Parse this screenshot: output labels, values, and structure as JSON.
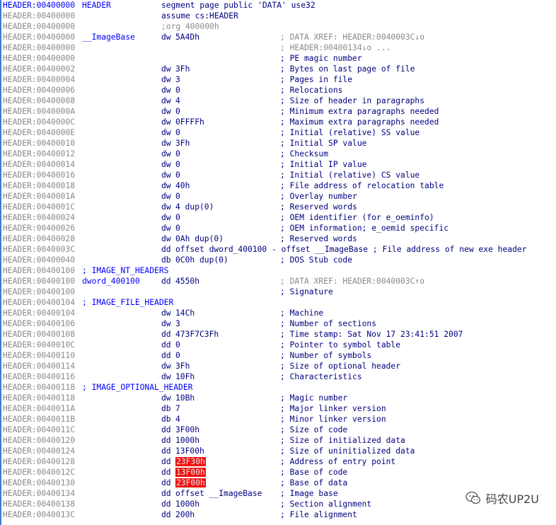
{
  "listing": {
    "lines": [
      {
        "addr": "HEADER:00400000",
        "label": "HEADER",
        "mn": "segment page public 'DATA' use32",
        "op": "",
        "comment": "",
        "xref": "",
        "first": true
      },
      {
        "addr": "HEADER:00400000",
        "label": "",
        "mn": "assume cs:HEADER",
        "op": "",
        "comment": "",
        "xref": ""
      },
      {
        "addr": "HEADER:00400000",
        "label": "",
        "mn": "",
        "op": ";org 400000h",
        "org": true,
        "comment": "",
        "xref": ""
      },
      {
        "addr": "HEADER:00400000",
        "label": "__ImageBase",
        "mn": "dw",
        "op": "5A4Dh",
        "comment": "",
        "xref": "; DATA XREF: HEADER:0040003C↓o"
      },
      {
        "addr": "HEADER:00400000",
        "label": "",
        "mn": "",
        "op": "",
        "comment": "",
        "xref": "; HEADER:00400134↓o ..."
      },
      {
        "addr": "HEADER:00400000",
        "label": "",
        "mn": "",
        "op": "",
        "comment": "; PE magic number",
        "xref": ""
      },
      {
        "addr": "HEADER:00400002",
        "label": "",
        "mn": "dw",
        "op": "3Fh",
        "comment": "; Bytes on last page of file",
        "xref": ""
      },
      {
        "addr": "HEADER:00400004",
        "label": "",
        "mn": "dw",
        "op": "3",
        "comment": "; Pages in file",
        "xref": ""
      },
      {
        "addr": "HEADER:00400006",
        "label": "",
        "mn": "dw",
        "op": "0",
        "comment": "; Relocations",
        "xref": ""
      },
      {
        "addr": "HEADER:00400008",
        "label": "",
        "mn": "dw",
        "op": "4",
        "comment": "; Size of header in paragraphs",
        "xref": ""
      },
      {
        "addr": "HEADER:0040000A",
        "label": "",
        "mn": "dw",
        "op": "0",
        "comment": "; Minimum extra paragraphs needed",
        "xref": ""
      },
      {
        "addr": "HEADER:0040000C",
        "label": "",
        "mn": "dw",
        "op": "0FFFFh",
        "comment": "; Maximum extra paragraphs needed",
        "xref": ""
      },
      {
        "addr": "HEADER:0040000E",
        "label": "",
        "mn": "dw",
        "op": "0",
        "comment": "; Initial (relative) SS value",
        "xref": ""
      },
      {
        "addr": "HEADER:00400010",
        "label": "",
        "mn": "dw",
        "op": "3Fh",
        "comment": "; Initial SP value",
        "xref": ""
      },
      {
        "addr": "HEADER:00400012",
        "label": "",
        "mn": "dw",
        "op": "0",
        "comment": "; Checksum",
        "xref": ""
      },
      {
        "addr": "HEADER:00400014",
        "label": "",
        "mn": "dw",
        "op": "0",
        "comment": "; Initial IP value",
        "xref": ""
      },
      {
        "addr": "HEADER:00400016",
        "label": "",
        "mn": "dw",
        "op": "0",
        "comment": "; Initial (relative) CS value",
        "xref": ""
      },
      {
        "addr": "HEADER:00400018",
        "label": "",
        "mn": "dw",
        "op": "40h",
        "comment": "; File address of relocation table",
        "xref": ""
      },
      {
        "addr": "HEADER:0040001A",
        "label": "",
        "mn": "dw",
        "op": "0",
        "comment": "; Overlay number",
        "xref": ""
      },
      {
        "addr": "HEADER:0040001C",
        "label": "",
        "mn": "dw",
        "op": "4 dup(0)",
        "comment": "; Reserved words",
        "xref": ""
      },
      {
        "addr": "HEADER:00400024",
        "label": "",
        "mn": "dw",
        "op": "0",
        "comment": "; OEM identifier (for e_oeminfo)",
        "xref": ""
      },
      {
        "addr": "HEADER:00400026",
        "label": "",
        "mn": "dw",
        "op": "0",
        "comment": "; OEM information; e_oemid specific",
        "xref": ""
      },
      {
        "addr": "HEADER:00400028",
        "label": "",
        "mn": "dw",
        "op": "0Ah dup(0)",
        "comment": "; Reserved words",
        "xref": ""
      },
      {
        "addr": "HEADER:0040003C",
        "label": "",
        "mn": "dd",
        "op": "offset dword_400100 - offset __ImageBase ; File address of new exe header",
        "comment": "",
        "xref": ""
      },
      {
        "addr": "HEADER:00400040",
        "label": "",
        "mn": "db",
        "op": "0C0h dup(0)",
        "comment": "; DOS Stub code",
        "xref": ""
      },
      {
        "addr": "HEADER:00400100",
        "label": "",
        "mn": "",
        "op": "",
        "comment": "",
        "xref": "",
        "section": "; IMAGE_NT_HEADERS"
      },
      {
        "addr": "HEADER:00400100",
        "label": "dword_400100",
        "mn": "dd",
        "op": "4550h",
        "comment": "",
        "xref": "; DATA XREF: HEADER:0040003C↑o"
      },
      {
        "addr": "HEADER:00400100",
        "label": "",
        "mn": "",
        "op": "",
        "comment": "; Signature",
        "xref": ""
      },
      {
        "addr": "HEADER:00400104",
        "label": "",
        "mn": "",
        "op": "",
        "comment": "",
        "xref": "",
        "section": "; IMAGE_FILE_HEADER"
      },
      {
        "addr": "HEADER:00400104",
        "label": "",
        "mn": "dw",
        "op": "14Ch",
        "comment": "; Machine",
        "xref": ""
      },
      {
        "addr": "HEADER:00400106",
        "label": "",
        "mn": "dw",
        "op": "3",
        "comment": "; Number of sections",
        "xref": ""
      },
      {
        "addr": "HEADER:00400108",
        "label": "",
        "mn": "dd",
        "op": "473F7C3Fh",
        "comment": "; Time stamp: Sat Nov 17 23:41:51 2007",
        "xref": ""
      },
      {
        "addr": "HEADER:0040010C",
        "label": "",
        "mn": "dd",
        "op": "0",
        "comment": "; Pointer to symbol table",
        "xref": ""
      },
      {
        "addr": "HEADER:00400110",
        "label": "",
        "mn": "dd",
        "op": "0",
        "comment": "; Number of symbols",
        "xref": ""
      },
      {
        "addr": "HEADER:00400114",
        "label": "",
        "mn": "dw",
        "op": "3Fh",
        "comment": "; Size of optional header",
        "xref": ""
      },
      {
        "addr": "HEADER:00400116",
        "label": "",
        "mn": "dw",
        "op": "10Fh",
        "comment": "; Characteristics",
        "xref": ""
      },
      {
        "addr": "HEADER:00400118",
        "label": "",
        "mn": "",
        "op": "",
        "comment": "",
        "xref": "",
        "section": "; IMAGE_OPTIONAL_HEADER"
      },
      {
        "addr": "HEADER:00400118",
        "label": "",
        "mn": "dw",
        "op": "10Bh",
        "comment": "; Magic number",
        "xref": ""
      },
      {
        "addr": "HEADER:0040011A",
        "label": "",
        "mn": "db",
        "op": "7",
        "comment": "; Major linker version",
        "xref": ""
      },
      {
        "addr": "HEADER:0040011B",
        "label": "",
        "mn": "db",
        "op": "4",
        "comment": "; Minor linker version",
        "xref": ""
      },
      {
        "addr": "HEADER:0040011C",
        "label": "",
        "mn": "dd",
        "op": "3F00h",
        "comment": "; Size of code",
        "xref": ""
      },
      {
        "addr": "HEADER:00400120",
        "label": "",
        "mn": "dd",
        "op": "1000h",
        "comment": "; Size of initialized data",
        "xref": ""
      },
      {
        "addr": "HEADER:00400124",
        "label": "",
        "mn": "dd",
        "op": "13F00h",
        "comment": "; Size of uninitialized data",
        "xref": ""
      },
      {
        "addr": "HEADER:00400128",
        "label": "",
        "mn": "dd",
        "op": "23F30h",
        "highlight": true,
        "comment": "; Address of entry point",
        "xref": ""
      },
      {
        "addr": "HEADER:0040012C",
        "label": "",
        "mn": "dd",
        "op": "13F00h",
        "highlight": true,
        "comment": "; Base of code",
        "xref": ""
      },
      {
        "addr": "HEADER:00400130",
        "label": "",
        "mn": "dd",
        "op": "23F00h",
        "highlight": true,
        "comment": "; Base of data",
        "xref": ""
      },
      {
        "addr": "HEADER:00400134",
        "label": "",
        "mn": "dd",
        "op": "offset __ImageBase",
        "comment": "; Image base",
        "xref": ""
      },
      {
        "addr": "HEADER:00400138",
        "label": "",
        "mn": "dd",
        "op": "1000h",
        "comment": "; Section alignment",
        "xref": ""
      },
      {
        "addr": "HEADER:0040013C",
        "label": "",
        "mn": "dd",
        "op": "200h",
        "comment": "; File alignment",
        "xref": ""
      }
    ]
  },
  "watermark": {
    "text": "码农UP2U",
    "icon": "wechat-icon"
  },
  "colors": {
    "address": "#8a8a8a",
    "code": "#000080",
    "label": "#0000ff",
    "highlight": "#ee1111"
  }
}
